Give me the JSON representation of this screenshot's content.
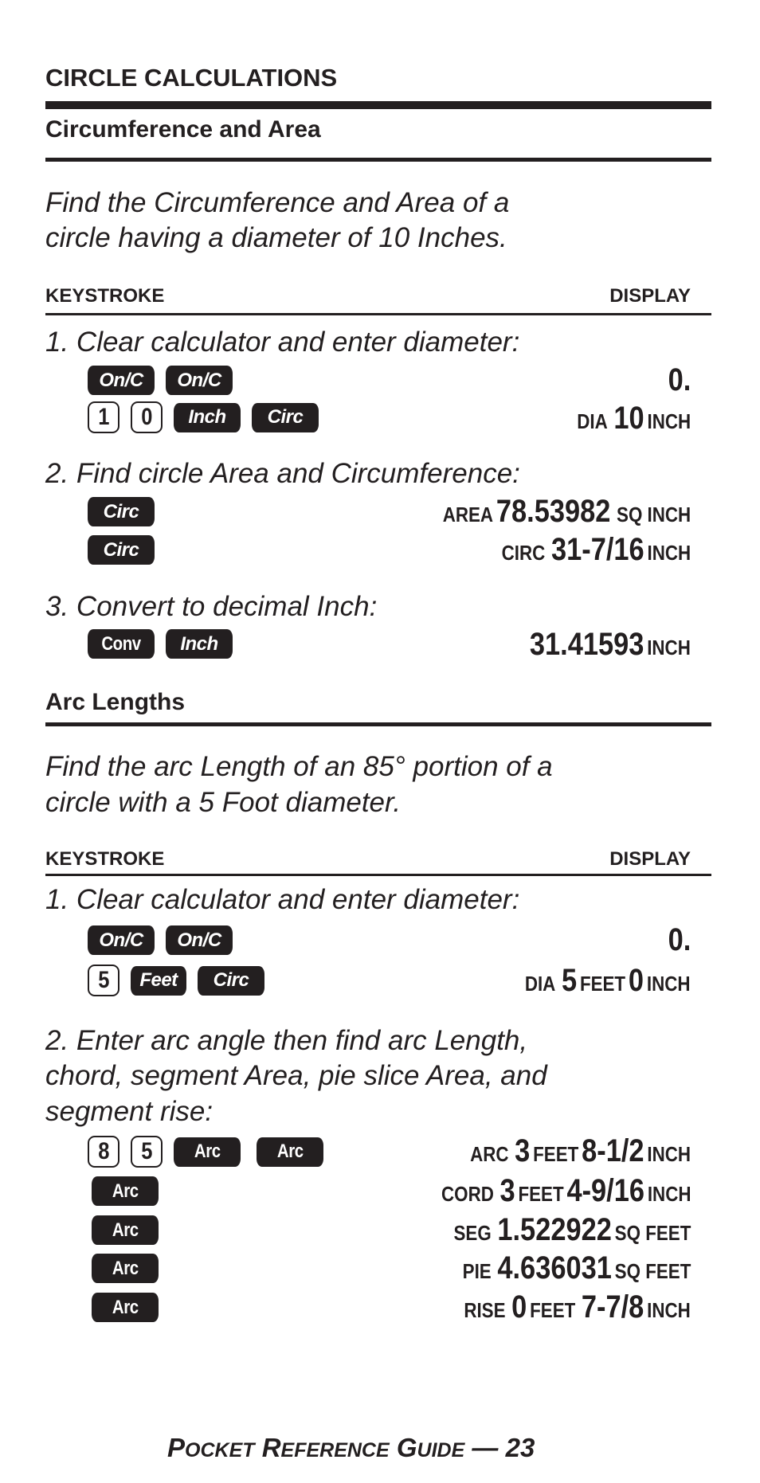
{
  "page": {
    "title": "CIRCLE CALCULATIONS",
    "footer": {
      "prefix_p": "P",
      "ocket": "OCKET",
      "r": "R",
      "eference": "EFERENCE",
      "g": "G",
      "uide": "UIDE",
      "sep": " — ",
      "page_number": "23"
    }
  },
  "column_headers": {
    "keystroke": "KEYSTROKE",
    "display": "DISPLAY"
  },
  "sections": [
    {
      "heading": "Circumference and Area",
      "intro": [
        "Find the Circumference and Area of a",
        "circle having a diameter of 10 Inches."
      ],
      "steps": [
        {
          "text": "1. Clear calculator and enter diameter:",
          "rows": [
            {
              "keys": [
                "On/C",
                "On/C"
              ],
              "display": {
                "label": "",
                "value": "0.",
                "unit": ""
              }
            },
            {
              "keys": [
                "1",
                "0",
                "Inch",
                "Circ"
              ],
              "display": {
                "label": "DIA",
                "value": "10",
                "unit": "INCH"
              }
            }
          ]
        },
        {
          "text": "2. Find circle Area and Circumference:",
          "rows": [
            {
              "keys": [
                "Circ"
              ],
              "display": {
                "label": "AREA",
                "value": "78.53982",
                "unit": "SQ INCH"
              }
            },
            {
              "keys": [
                "Circ"
              ],
              "display": {
                "label": "CIRC",
                "value": "31-7/16",
                "unit": "INCH"
              }
            }
          ]
        },
        {
          "text": "3. Convert to decimal Inch:",
          "rows": [
            {
              "keys": [
                "Conv",
                "Inch"
              ],
              "display": {
                "label": "",
                "value": "31.41593",
                "unit": "INCH"
              }
            }
          ]
        }
      ]
    },
    {
      "heading": "Arc Lengths",
      "intro": [
        "Find the arc Length of an 85° portion of a",
        "circle with a 5 Foot diameter."
      ],
      "steps": [
        {
          "text": "1. Clear calculator and enter diameter:",
          "rows": [
            {
              "keys": [
                "On/C",
                "On/C"
              ],
              "display": {
                "label": "",
                "value": "0.",
                "unit": ""
              }
            },
            {
              "keys": [
                "5",
                "Feet",
                "Circ"
              ],
              "display": {
                "label": "DIA",
                "value": "5",
                "unit": "FEET",
                "value2": "0",
                "unit2": "INCH"
              }
            }
          ]
        },
        {
          "text_lines": [
            "2. Enter arc angle then find arc Length,",
            "chord, segment Area, pie slice Area, and",
            "segment rise:"
          ],
          "rows": [
            {
              "keys": [
                "8",
                "5",
                "Arc",
                "Arc"
              ],
              "display": {
                "label": "ARC",
                "value": "3",
                "unit": "FEET",
                "value2": "8-1/2",
                "unit2": "INCH"
              }
            },
            {
              "keys": [
                "Arc"
              ],
              "display": {
                "label": "CORD",
                "value": "3",
                "unit": "FEET",
                "value2": "4-9/16",
                "unit2": "INCH"
              }
            },
            {
              "keys": [
                "Arc"
              ],
              "display": {
                "label": "SEG",
                "value": "1.522922",
                "unit": "SQ FEET"
              }
            },
            {
              "keys": [
                "Arc"
              ],
              "display": {
                "label": "PIE",
                "value": "4.636031",
                "unit": "SQ FEET"
              }
            },
            {
              "keys": [
                "Arc"
              ],
              "display": {
                "label": "RISE",
                "value": "0",
                "unit": "FEET",
                "value2": "7-7/8",
                "unit2": "INCH"
              }
            }
          ]
        }
      ]
    }
  ]
}
